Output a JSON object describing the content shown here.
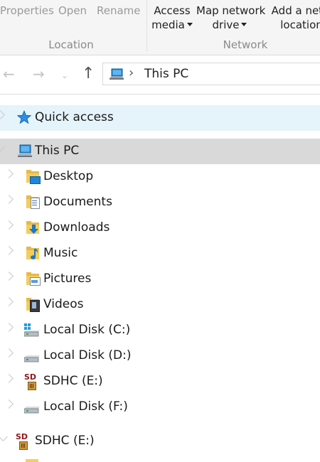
{
  "ribbon": {
    "properties": "Properties",
    "open": "Open",
    "rename": "Rename",
    "location_group": "Location",
    "access_media_1": "Access",
    "access_media_2": "media",
    "map_drive_1": "Map network",
    "map_drive_2": "drive",
    "add_location_1": "Add a netw",
    "add_location_2": "location",
    "network_group": "Network"
  },
  "address": {
    "current": "This PC"
  },
  "tree": {
    "quick_access": "Quick access",
    "this_pc": "This PC",
    "items": [
      {
        "label": "Desktop",
        "icon": "desktop-folder-icon"
      },
      {
        "label": "Documents",
        "icon": "documents-folder-icon"
      },
      {
        "label": "Downloads",
        "icon": "downloads-folder-icon"
      },
      {
        "label": "Music",
        "icon": "music-folder-icon"
      },
      {
        "label": "Pictures",
        "icon": "pictures-folder-icon"
      },
      {
        "label": "Videos",
        "icon": "videos-folder-icon"
      },
      {
        "label": "Local Disk (C:)",
        "icon": "system-drive-icon"
      },
      {
        "label": "Local Disk (D:)",
        "icon": "drive-icon"
      },
      {
        "label": "SDHC (E:)",
        "icon": "sd-card-icon"
      },
      {
        "label": "Local Disk (F:)",
        "icon": "drive-icon"
      }
    ],
    "sdhc_root": "SDHC (E:)"
  },
  "icon_text": {
    "sd": "SD"
  },
  "colors": {
    "accent_blue": "#1e7fd0",
    "folder_yellow": "#f5cd5b",
    "selected_bg": "#d9d9d9",
    "quick_access_bg": "#e5f3fb"
  }
}
